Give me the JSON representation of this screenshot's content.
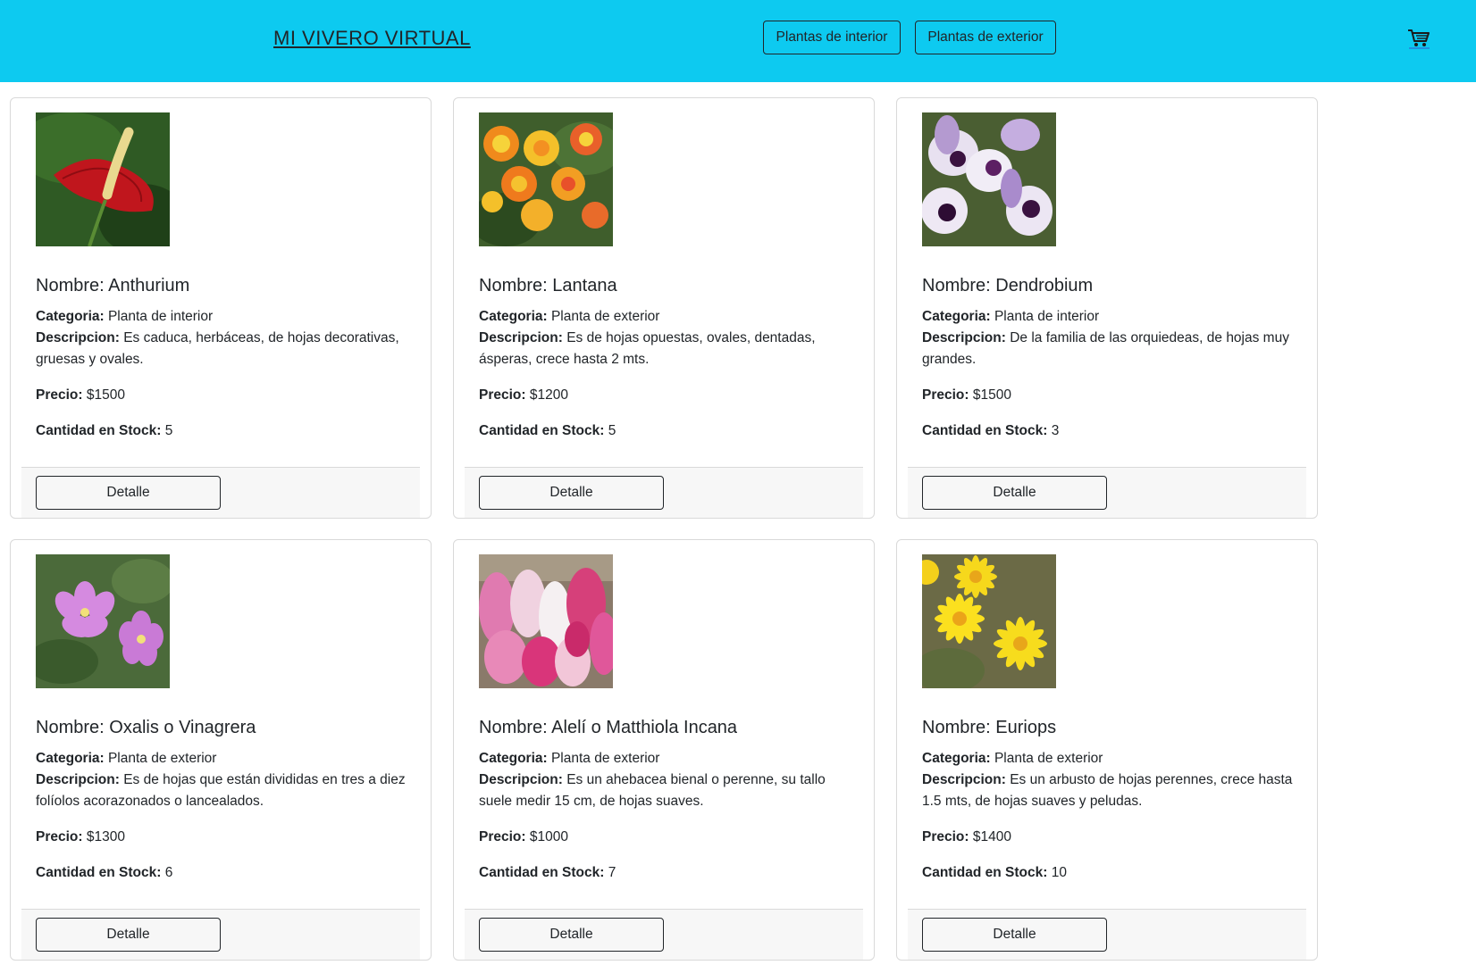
{
  "navbar": {
    "brand": "MI VIVERO VIRTUAL",
    "btn_interior": "Plantas de interior",
    "btn_exterior": "Plantas de exterior",
    "cart_icon": "shopping-cart-icon",
    "bg_color": "#0dcaf0"
  },
  "labels": {
    "nombre": "Nombre:",
    "categoria": "Categoria:",
    "descripcion": "Descripcion:",
    "precio": "Precio:",
    "stock": "Cantidad en Stock:",
    "detalle": "Detalle"
  },
  "products": [
    {
      "name": "Anthurium",
      "category": "Planta de interior",
      "description": "Es caduca, herbáceas, de hojas decorativas, gruesas y ovales.",
      "price": "$1500",
      "stock": "5"
    },
    {
      "name": "Lantana",
      "category": "Planta de exterior",
      "description": "Es de hojas opuestas, ovales, dentadas, ásperas, crece hasta 2 mts.",
      "price": "$1200",
      "stock": "5"
    },
    {
      "name": "Dendrobium",
      "category": "Planta de interior",
      "description": "De la familia de las orquiedeas, de hojas muy grandes.",
      "price": "$1500",
      "stock": "3"
    },
    {
      "name": "Oxalis o Vinagrera",
      "category": "Planta de exterior",
      "description": "Es de hojas que están divididas en tres a diez folíolos acorazonados o lancealados.",
      "price": "$1300",
      "stock": "6"
    },
    {
      "name": "Alelí o Matthiola Incana",
      "category": "Planta de exterior",
      "description": "Es un ahebacea bienal o perenne, su tallo suele medir 15 cm, de hojas suaves.",
      "price": "$1000",
      "stock": "7"
    },
    {
      "name": "Euriops",
      "category": "Planta de exterior",
      "description": "Es un arbusto de hojas perennes, crece hasta 1.5 mts, de hojas suaves y peludas.",
      "price": "$1400",
      "stock": "10"
    }
  ]
}
